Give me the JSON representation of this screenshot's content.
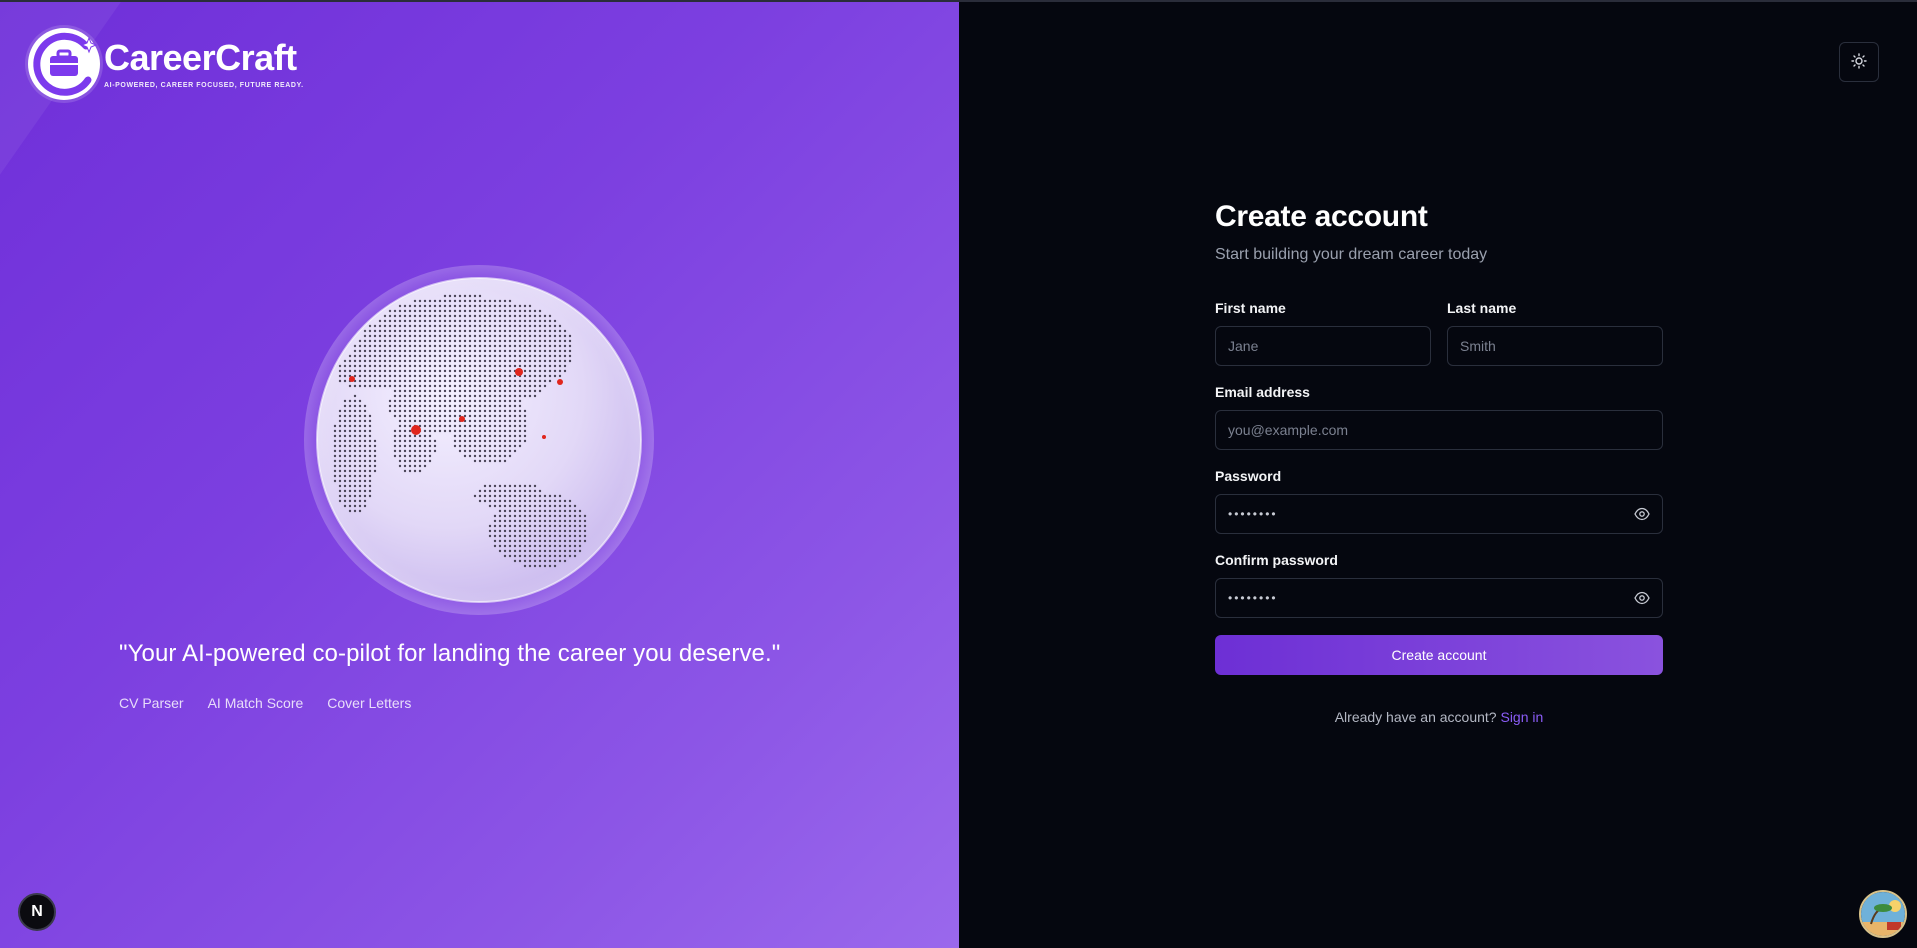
{
  "brand": {
    "name": "CareerCraft",
    "tagline": "AI-POWERED, CAREER FOCUSED, FUTURE READY."
  },
  "hero": {
    "quote": "\"Your AI-powered co-pilot for landing the career you deserve.\"",
    "features": [
      "CV Parser",
      "AI Match Score",
      "Cover Letters"
    ]
  },
  "form": {
    "title": "Create account",
    "subtitle": "Start building your dream career today",
    "first_name": {
      "label": "First name",
      "placeholder": "Jane"
    },
    "last_name": {
      "label": "Last name",
      "placeholder": "Smith"
    },
    "email": {
      "label": "Email address",
      "placeholder": "you@example.com"
    },
    "password": {
      "label": "Password",
      "value": "••••••••"
    },
    "confirm_password": {
      "label": "Confirm password",
      "value": "••••••••"
    },
    "submit_label": "Create account",
    "signin_prompt": "Already have an account?",
    "signin_link": "Sign in"
  },
  "dev_badge": {
    "label": "N"
  },
  "icons": {
    "theme_toggle": "sun-icon",
    "password_visibility": "eye-icon"
  },
  "colors": {
    "accent": "#7c3aed",
    "left_panel_start": "#6f2fd9",
    "left_panel_end": "#9a68ec",
    "right_panel_bg": "#05070f",
    "link": "#8b5cf6"
  }
}
